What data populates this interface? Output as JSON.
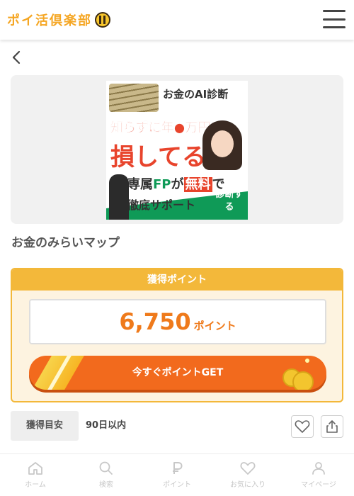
{
  "header": {
    "logo_text": "ポイ活倶楽部"
  },
  "banner": {
    "top_text": "お金のAI診断",
    "line1": "知らずに年●万円",
    "line2": "損してる!?",
    "line3_prefix": "専属",
    "line3_fp": "FP",
    "line3_mid": "が",
    "line3_free": "無料",
    "line3_suffix": "で",
    "line4": "徹底サポート",
    "badge": "診断する"
  },
  "offer": {
    "title": "お金のみらいマップ"
  },
  "points": {
    "header": "獲得ポイント",
    "value": "6,750",
    "unit": "ポイント",
    "button": "今すぐポイントGET"
  },
  "target": {
    "label": "獲得目安",
    "value": "90日以内"
  },
  "bottom_nav": [
    {
      "label": "ホーム",
      "icon": "home-icon"
    },
    {
      "label": "検索",
      "icon": "search-icon"
    },
    {
      "label": "ポイント",
      "icon": "point-icon"
    },
    {
      "label": "お気に入り",
      "icon": "heart-icon"
    },
    {
      "label": "マイページ",
      "icon": "user-icon"
    }
  ],
  "colors": {
    "accent_orange": "#f26a1d",
    "gold": "#f3b83a",
    "points_text": "#ef7a1b",
    "nav_inactive": "#c8c8c8"
  }
}
